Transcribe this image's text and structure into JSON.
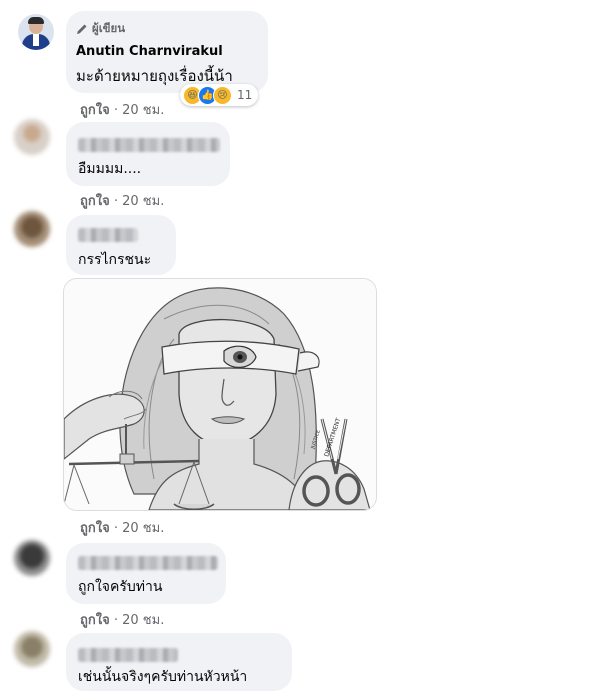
{
  "comments": [
    {
      "author_tag": "ผู้เขียน",
      "author_name": "Anutin Charnvirakul",
      "text": "มะด้ายหมายถุงเรื่องนี้น้า",
      "reaction_count": "11",
      "like_label": "ถูกใจ",
      "time": "20 ชม."
    },
    {
      "text": "อืมมมม....",
      "like_label": "ถูกใจ",
      "time": "20 ชม."
    },
    {
      "text": "กรรไกรชนะ",
      "like_label": "ถูกใจ",
      "time": "20 ชม.",
      "image_labels": [
        "DEPARTMENT",
        "JUSTICE"
      ]
    },
    {
      "text": "ถูกใจครับท่าน",
      "like_label": "ถูกใจ",
      "time": "20 ชม."
    },
    {
      "text": "เช่นนั้นจริงๆครับท่านหัวหน้า"
    }
  ],
  "separator": " · ",
  "colors": {
    "bubble": "#f0f2f5",
    "meta_text": "#65676b",
    "reaction_haha": "#f7b928",
    "reaction_like": "#1877f2"
  }
}
